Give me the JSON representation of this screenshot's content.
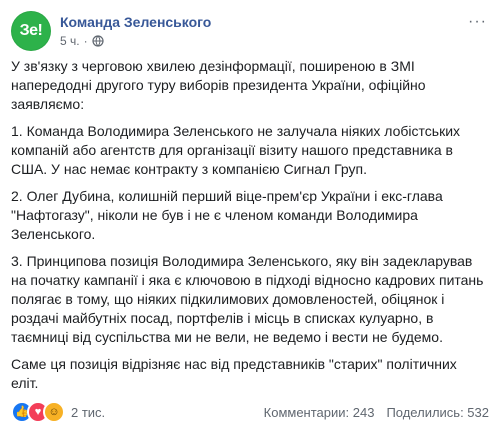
{
  "page": {
    "avatar_text": "Зе!",
    "name": "Команда Зеленського",
    "time": "5 ч.",
    "separator": "·",
    "more_label": "···"
  },
  "post": {
    "paragraphs": [
      "У зв'язку з черговою хвилею дезінформації, поширеною в ЗМІ напередодні другого туру виборів президента України, офіційно заявляємо:",
      "1. Команда Володимира Зеленського не залучала ніяких лобістських компаній або агентств для організації візиту нашого представника в США. У нас немає контракту з компанією Сигнал Груп.",
      "2. Олег Дубина, колишній перший віце-прем'єр України і екс-глава \"Нафтогазу\", ніколи не був і не є членом команди Володимира Зеленського.",
      "3. Принципова позиція Володимира Зеленського, яку він задекларував на початку кампанії і яка є ключовою в підході відносно кадрових питань полягає в тому, що ніяких підкилимових домовленостей, обіцянок і роздачі майбутніх посад, портфелів і місць в списках кулуарно, в таємниці від суспільства ми не вели, не ведемо і вести не будемо.",
      "Саме ця позиція відрізняє нас від представників \"старих\" політичних еліт."
    ]
  },
  "footer": {
    "reactions": [
      "like",
      "love",
      "haha"
    ],
    "reaction_count": "2 тис.",
    "comments": "Комментарии: 243",
    "shares": "Поделились: 532"
  },
  "colors": {
    "name": "#385898",
    "avatar_bg": "#2db24a",
    "meta": "#616770"
  }
}
